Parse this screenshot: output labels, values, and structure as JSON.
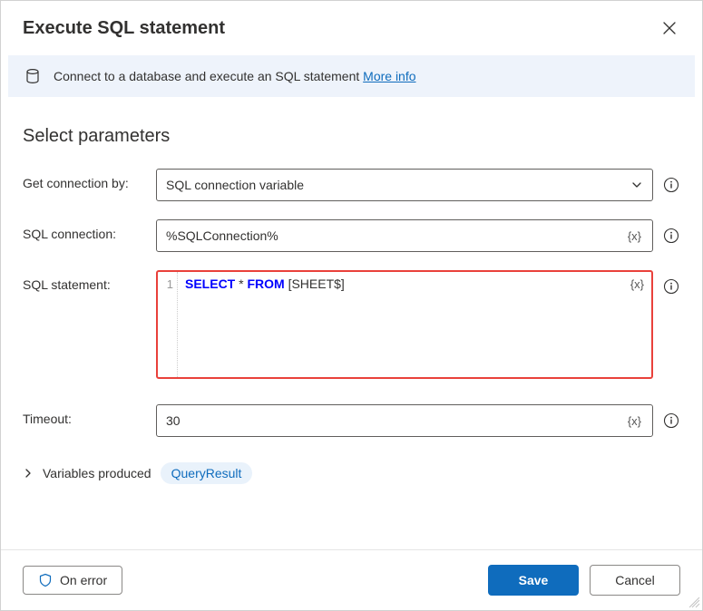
{
  "header": {
    "title": "Execute SQL statement"
  },
  "banner": {
    "text": "Connect to a database and execute an SQL statement ",
    "link_label": "More info"
  },
  "section_title": "Select parameters",
  "fields": {
    "get_connection": {
      "label": "Get connection by:",
      "value": "SQL connection variable"
    },
    "sql_connection": {
      "label": "SQL connection:",
      "value": "%SQLConnection%"
    },
    "sql_statement": {
      "label": "SQL statement:",
      "line_number": "1",
      "kw1": "SELECT",
      "star": " * ",
      "kw2": "FROM",
      "rest": " [SHEET$]"
    },
    "timeout": {
      "label": "Timeout:",
      "value": "30"
    }
  },
  "var_badge": "{x}",
  "variables_produced": {
    "label": "Variables produced",
    "badge": "QueryResult"
  },
  "footer": {
    "on_error": "On error",
    "save": "Save",
    "cancel": "Cancel"
  }
}
